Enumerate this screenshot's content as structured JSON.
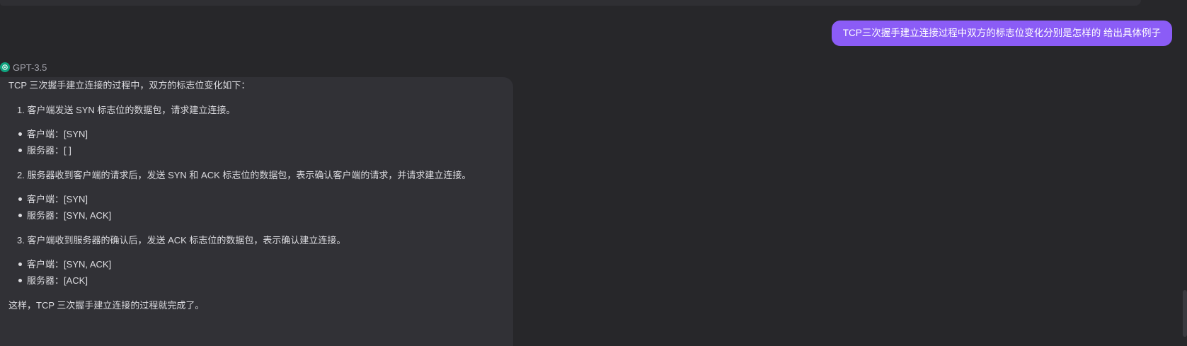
{
  "conversation": {
    "user_message": "TCP三次握手建立连接过程中双方的标志位变化分别是怎样的   给出具体例子",
    "model_name": "GPT-3.5",
    "answer": {
      "intro": "TCP 三次握手建立连接的过程中，双方的标志位变化如下：",
      "steps": [
        {
          "title": "1. 客户端发送 SYN 标志位的数据包，请求建立连接。",
          "client": "客户端：[SYN]",
          "server": "服务器：[ ]"
        },
        {
          "title": "2. 服务器收到客户端的请求后，发送 SYN 和 ACK 标志位的数据包，表示确认客户端的请求，并请求建立连接。",
          "client": "客户端：[SYN]",
          "server": "服务器：[SYN, ACK]"
        },
        {
          "title": "3. 客户端收到服务器的确认后，发送 ACK 标志位的数据包，表示确认建立连接。",
          "client": "客户端：[SYN, ACK]",
          "server": "服务器：[ACK]"
        }
      ],
      "conclusion": "这样，TCP 三次握手建立连接的过程就完成了。"
    }
  },
  "colors": {
    "background": "#27272a",
    "user_bubble": "#8b5cf6",
    "answer_card": "#313136",
    "model_icon": "#10a37f"
  },
  "icons": {
    "model": "openai-logo-icon"
  }
}
